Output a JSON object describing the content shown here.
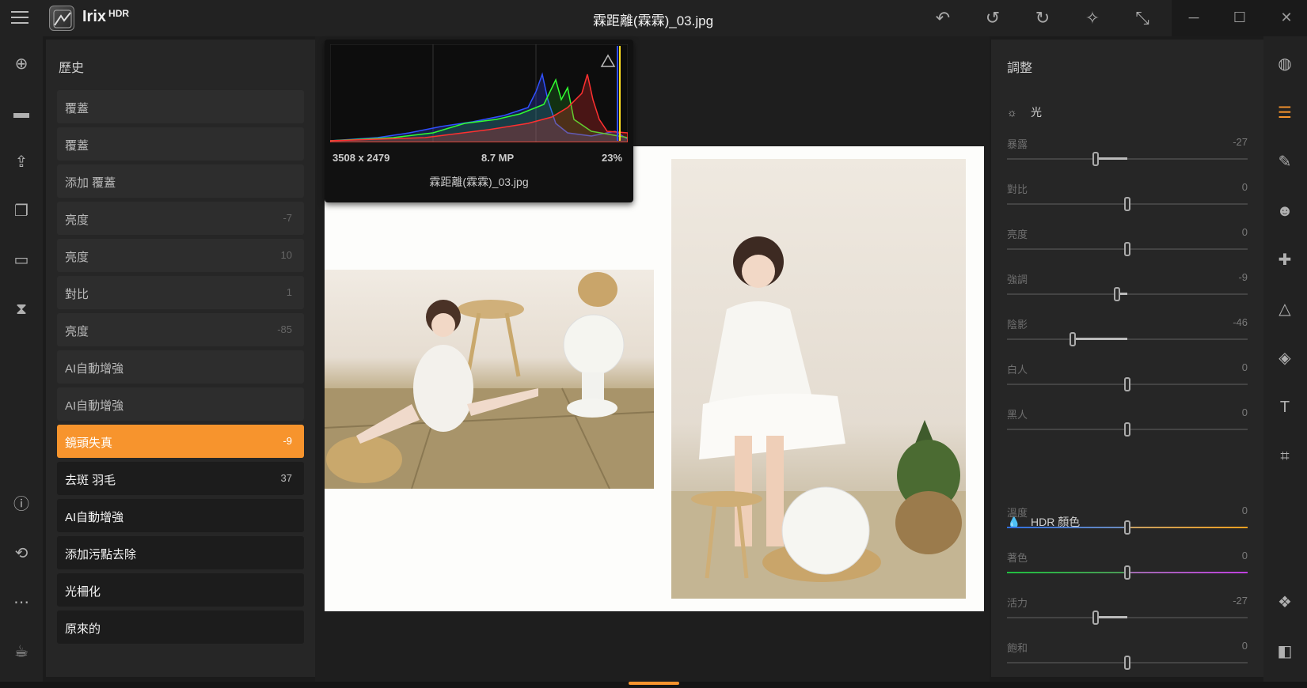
{
  "app": {
    "name": "Irix",
    "sup": "HDR"
  },
  "window": {
    "title": "霖距離(霖霖)_03.jpg"
  },
  "titlebar_icons": [
    "undo-all-icon",
    "undo-icon",
    "redo-icon",
    "ai-magic-icon",
    "collapse-icon"
  ],
  "window_controls": {
    "minimize": "─",
    "maximize": "☐",
    "close": "✕"
  },
  "left_icons": [
    "add-icon",
    "folder-icon",
    "export-icon",
    "batch-icon",
    "window-icon",
    "compare-icon",
    "info-icon",
    "history-icon",
    "more-icon",
    "donate-icon"
  ],
  "history": {
    "title": "歷史",
    "items": [
      {
        "label": "覆蓋",
        "value": ""
      },
      {
        "label": "覆蓋",
        "value": ""
      },
      {
        "label": "添加 覆蓋",
        "value": ""
      },
      {
        "label": "亮度",
        "value": "-7"
      },
      {
        "label": "亮度",
        "value": "10"
      },
      {
        "label": "對比",
        "value": "1"
      },
      {
        "label": "亮度",
        "value": "-85"
      },
      {
        "label": "AI自動增強",
        "value": ""
      },
      {
        "label": "AI自動增強",
        "value": ""
      },
      {
        "label": "鏡頭失真",
        "value": "-9"
      },
      {
        "label": "去斑 羽毛",
        "value": "37"
      },
      {
        "label": "AI自動增強",
        "value": ""
      },
      {
        "label": "添加污點去除",
        "value": ""
      },
      {
        "label": "光柵化",
        "value": ""
      },
      {
        "label": "原來的",
        "value": ""
      }
    ],
    "selected_index": 9
  },
  "histogram": {
    "resolution": "3508 x 2479",
    "megapixels": "8.7 MP",
    "zoom": "23%",
    "filename": "霖距離(霖霖)_03.jpg",
    "colors": {
      "red": "#ff3030",
      "green": "#30ff30",
      "blue": "#3050ff",
      "yellow": "#ffe020"
    }
  },
  "adjust": {
    "title": "調整",
    "light": {
      "title": "光",
      "sliders": [
        {
          "label": "暴露",
          "value": "-27"
        },
        {
          "label": "對比",
          "value": "0"
        },
        {
          "label": "亮度",
          "value": "0"
        },
        {
          "label": "強調",
          "value": "-9"
        },
        {
          "label": "陰影",
          "value": "-46"
        },
        {
          "label": "白人",
          "value": "0"
        },
        {
          "label": "黑人",
          "value": "0"
        }
      ]
    },
    "color": {
      "title": "HDR 顏色",
      "sliders": [
        {
          "label": "溫度",
          "value": "0"
        },
        {
          "label": "著色",
          "value": "0"
        },
        {
          "label": "活力",
          "value": "-27"
        },
        {
          "label": "飽和",
          "value": "0"
        }
      ]
    }
  },
  "right_icons": [
    "presets-icon",
    "adjust-icon",
    "brush-icon",
    "face-icon",
    "heal-icon",
    "structure-icon",
    "layers-icon",
    "text-icon",
    "crop-icon",
    "stack-icon",
    "split-view-icon"
  ],
  "accent": "#f7942d"
}
